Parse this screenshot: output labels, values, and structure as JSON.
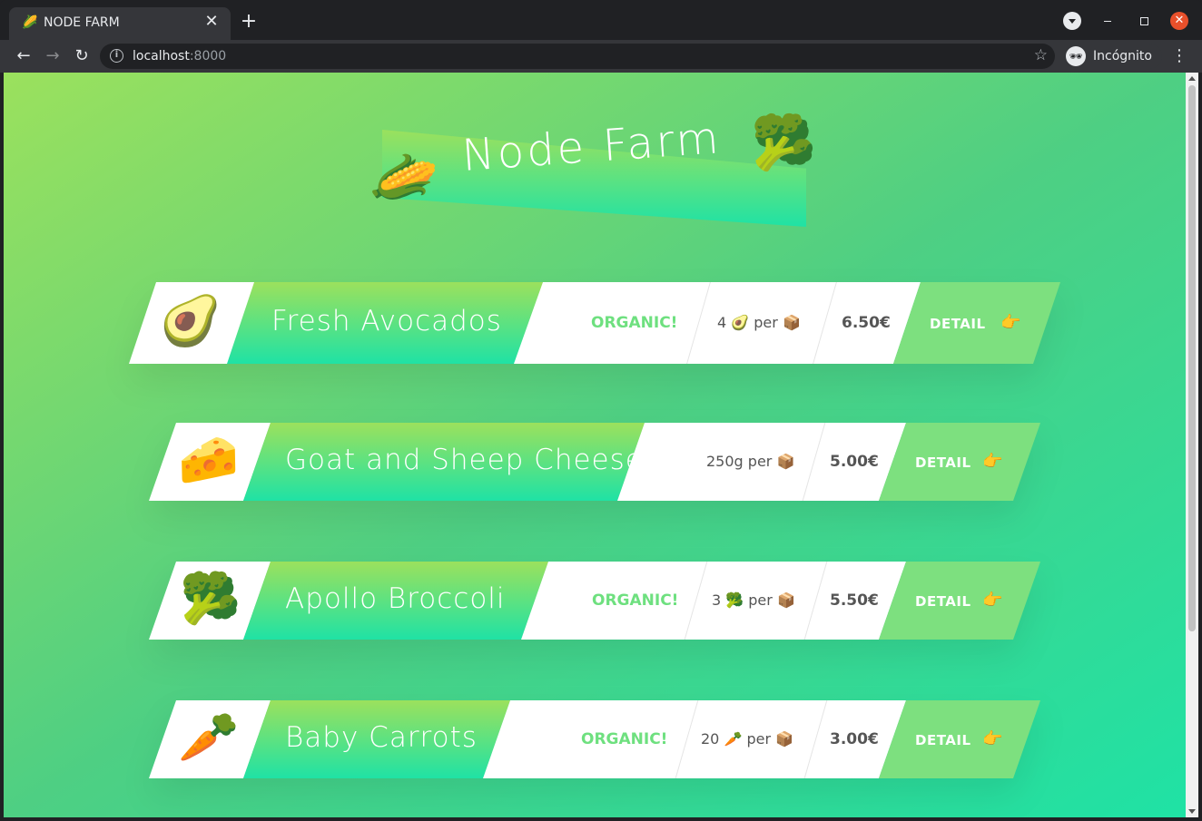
{
  "browser": {
    "tab_title": "NODE FARM",
    "tab_favicon": "🌽",
    "tab_close": "✕",
    "new_tab": "+",
    "url_host": "localhost",
    "url_port": ":8000",
    "incognito_label": "Incógnito",
    "icons": {
      "back": "←",
      "forward": "→",
      "reload": "↻",
      "info": "i",
      "star": "☆",
      "incognito": "🕶",
      "menu": "⋮",
      "close": "✕"
    }
  },
  "header": {
    "title": "Node Farm",
    "left_emoji": "🌽",
    "right_emoji": "🥦"
  },
  "products": [
    {
      "emoji": "🥑",
      "name": "Fresh Avocados",
      "organic": "ORGANIC!",
      "quantity": "4 🥑 per 📦",
      "price": "6.50€",
      "detail": "DETAIL",
      "hand": "👉"
    },
    {
      "emoji": "🧀",
      "name": "Goat and Sheep Cheese",
      "organic": "",
      "quantity": "250g per 📦",
      "price": "5.00€",
      "detail": "DETAIL",
      "hand": "👉"
    },
    {
      "emoji": "🥦",
      "name": "Apollo Broccoli",
      "organic": "ORGANIC!",
      "quantity": "3 🥦 per 📦",
      "price": "5.50€",
      "detail": "DETAIL",
      "hand": "👉"
    },
    {
      "emoji": "🥕",
      "name": "Baby Carrots",
      "organic": "ORGANIC!",
      "quantity": "20 🥕 per 📦",
      "price": "3.00€",
      "detail": "DETAIL",
      "hand": "👉"
    }
  ],
  "colors": {
    "gradient_start": "#9be15d",
    "gradient_end": "#1fe2a5",
    "organic": "#6ee07f",
    "detail_bg": "#7de07f"
  }
}
